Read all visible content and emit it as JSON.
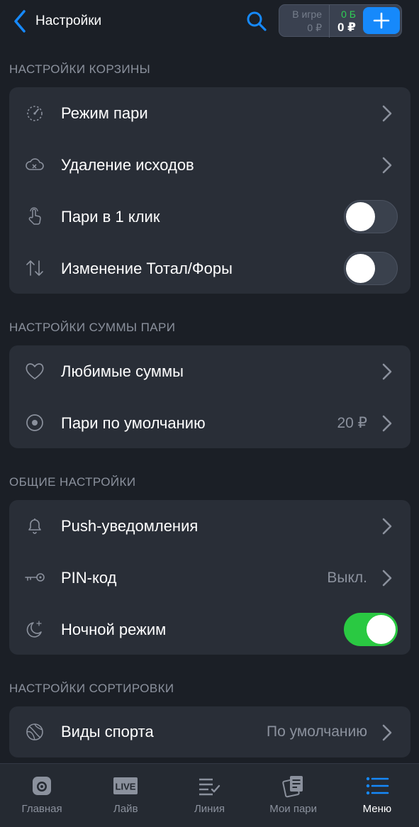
{
  "header": {
    "back_label": "Настройки",
    "balance": {
      "in_game_label": "В игре",
      "in_game_value": "0 ₽",
      "bonus": "0 Б",
      "money": "0 ₽"
    }
  },
  "sections": {
    "basket": {
      "title": "НАСТРОЙКИ КОРЗИНЫ",
      "rows": [
        {
          "label": "Режим пари",
          "icon": "speedometer-icon"
        },
        {
          "label": "Удаление исходов",
          "icon": "cloud-remove-icon"
        },
        {
          "label": "Пари в 1 клик",
          "icon": "tap-hand-icon",
          "toggle": false
        },
        {
          "label": "Изменение Тотал/Форы",
          "icon": "up-down-arrows-icon",
          "toggle": false
        }
      ]
    },
    "amount": {
      "title": "НАСТРОЙКИ СУММЫ ПАРИ",
      "rows": [
        {
          "label": "Любимые суммы",
          "icon": "heart-icon"
        },
        {
          "label": "Пари по умолчанию",
          "icon": "target-icon",
          "value": "20 ₽"
        }
      ]
    },
    "general": {
      "title": "ОБЩИЕ НАСТРОЙКИ",
      "rows": [
        {
          "label": "Push-уведомления",
          "icon": "bell-icon"
        },
        {
          "label": "PIN-код",
          "icon": "key-icon",
          "value": "Выкл."
        },
        {
          "label": "Ночной режим",
          "icon": "moon-stars-icon",
          "toggle": true
        }
      ]
    },
    "sorting": {
      "title": "НАСТРОЙКИ СОРТИРОВКИ",
      "rows": [
        {
          "label": "Виды спорта",
          "icon": "ball-icon",
          "value": "По умолчанию"
        }
      ]
    }
  },
  "tabbar": [
    {
      "label": "Главная",
      "icon": "home-icon"
    },
    {
      "label": "Лайв",
      "icon": "live-icon",
      "badge": "LIVE"
    },
    {
      "label": "Линия",
      "icon": "line-list-icon"
    },
    {
      "label": "Мои пари",
      "icon": "my-bets-icon"
    },
    {
      "label": "Меню",
      "icon": "menu-icon",
      "active": true
    }
  ],
  "colors": {
    "background": "#1b1f26",
    "card": "#292e37",
    "accent_blue": "#1689fb",
    "toggle_on": "#2ac942",
    "muted_text": "#8b919d"
  }
}
